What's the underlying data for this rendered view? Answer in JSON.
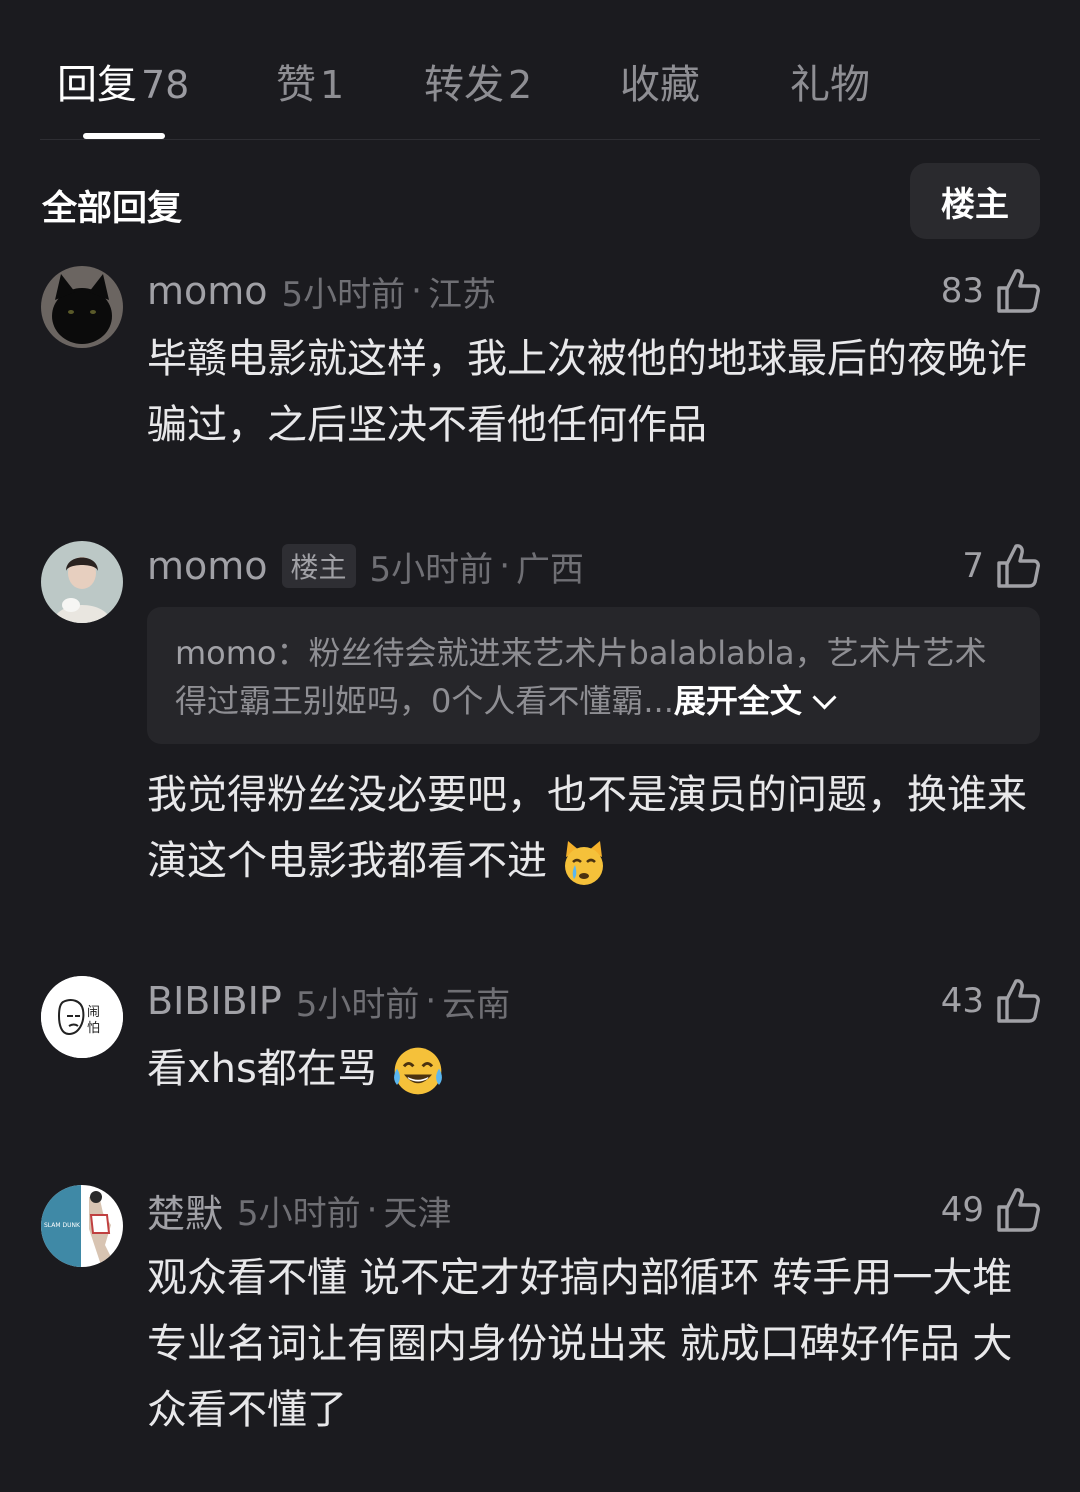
{
  "tabs": [
    {
      "label": "回复",
      "count": "78"
    },
    {
      "label": "赞",
      "count": "1"
    },
    {
      "label": "转发",
      "count": "2"
    },
    {
      "label": "收藏",
      "count": ""
    },
    {
      "label": "礼物",
      "count": ""
    }
  ],
  "filter": {
    "title": "全部回复",
    "owner_button": "楼主"
  },
  "comments": [
    {
      "username": "momo",
      "time": "5小时前",
      "region": "江苏",
      "likes": "83",
      "text": "毕赣电影就这样，我上次被他的地球最后的夜晚诈骗过，之后坚决不看他任何作品",
      "avatar": "black-cat-avatar"
    },
    {
      "username": "momo",
      "badge": "楼主",
      "time": "5小时前",
      "region": "广西",
      "likes": "7",
      "quote": {
        "user": "momo",
        "sep": "：",
        "text": "粉丝待会就进来艺术片balablabla，艺术片艺术得过霸王别姬吗，0个人看不懂霸...",
        "expand": "展开全文"
      },
      "text": "我觉得粉丝没必要吧，也不是演员的问题，换谁来演这个电影我都看不进",
      "emoji": "crying-cat-emoji",
      "avatar": "woman-photo-avatar"
    },
    {
      "username": "BIBIBIP",
      "time": "5小时前",
      "region": "云南",
      "likes": "43",
      "text": "看xhs都在骂",
      "emoji": "tears-of-joy-emoji",
      "avatar_text": "闹怕"
    },
    {
      "username": "楚默",
      "time": "5小时前",
      "region": "天津",
      "likes": "49",
      "text": "观众看不懂 说不定才好搞内部循环 转手用一大堆专业名词让有圈内身份说出来 就成口碑好作品 大众看不懂了",
      "avatar_text": "SLAM DUNK"
    }
  ],
  "separator": "·",
  "colors": {
    "background": "#1b1b1f",
    "text_primary": "#e8e8ea",
    "text_secondary": "#a1a1a6",
    "text_muted": "#6f6f74",
    "quote_bg": "#26262a"
  }
}
